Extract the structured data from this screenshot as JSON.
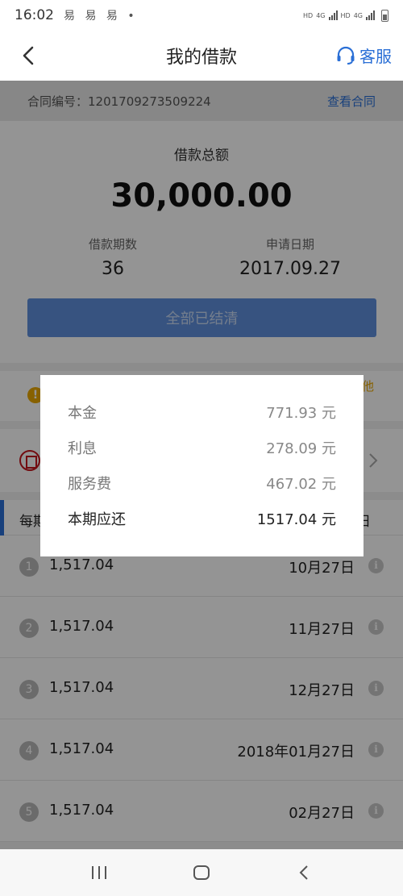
{
  "status_bar": {
    "time": "16:02",
    "notifications": "易 易 易 •",
    "network_1": "HD",
    "network_2": "4G",
    "network_3": "HD",
    "network_4": "4G"
  },
  "nav": {
    "title": "我的借款",
    "service_label": "客服"
  },
  "contract": {
    "number_label": "合同编号：1201709273509224",
    "view_label": "查看合同"
  },
  "summary": {
    "total_label": "借款总额",
    "total_amount": "30,000.00",
    "periods_label": "借款期数",
    "periods_value": "36",
    "date_label": "申请日期",
    "date_value": "2017.09.27",
    "settled_button": "全部已结清"
  },
  "notice": {
    "other_text": "他"
  },
  "schedule": {
    "header_left": "每期",
    "header_right": "日",
    "rows": [
      {
        "index": "1",
        "amount": "1,517.04",
        "date": "10月27日"
      },
      {
        "index": "2",
        "amount": "1,517.04",
        "date": "11月27日"
      },
      {
        "index": "3",
        "amount": "1,517.04",
        "date": "12月27日"
      },
      {
        "index": "4",
        "amount": "1,517.04",
        "date": "2018年01月27日"
      },
      {
        "index": "5",
        "amount": "1,517.04",
        "date": "02月27日"
      }
    ]
  },
  "dialog": {
    "principal_label": "本金",
    "principal_value": "771.93 元",
    "interest_label": "利息",
    "interest_value": "278.09 元",
    "fee_label": "服务费",
    "fee_value": "467.02 元",
    "due_label": "本期应还",
    "due_value": "1517.04 元"
  },
  "colors": {
    "accent": "#2a6fd6",
    "button": "#5f8fdc",
    "warning": "#e8a700"
  }
}
